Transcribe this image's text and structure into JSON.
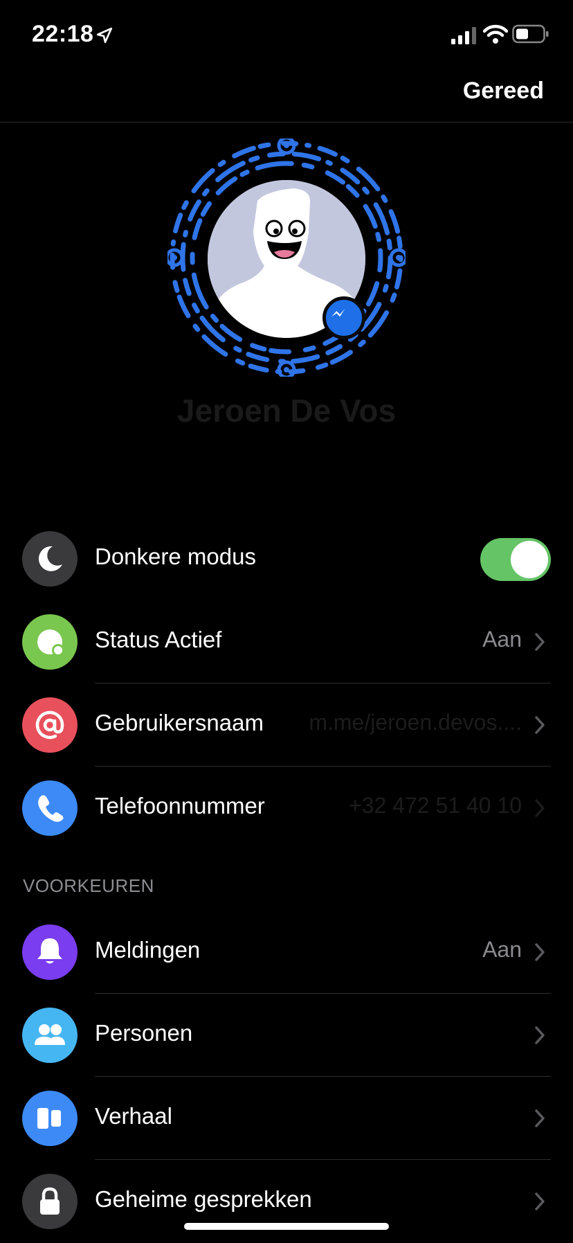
{
  "status_bar": {
    "time": "22:18"
  },
  "nav": {
    "done_label": "Gereed"
  },
  "profile": {
    "name": "Jeroen De Vos"
  },
  "rows": {
    "dark_mode": {
      "label": "Donkere modus",
      "toggle_on": true,
      "icon": "moon-icon",
      "color": "#3a3a3c"
    },
    "status": {
      "label": "Status Actief",
      "value": "Aan",
      "icon": "active-status-icon",
      "color": "#7ac74f"
    },
    "username": {
      "label": "Gebruikersnaam",
      "value": "m.me/jeroen.devos....",
      "icon": "at-icon",
      "color": "#e8505b"
    },
    "phone": {
      "label": "Telefoonnummer",
      "value": "+32 472 51 40 10",
      "icon": "phone-icon",
      "color": "#3d8af7"
    }
  },
  "preferences": {
    "section_title": "VOORKEUREN",
    "notifications": {
      "label": "Meldingen",
      "value": "Aan",
      "icon": "bell-icon",
      "color": "#7a3df0"
    },
    "people": {
      "label": "Personen",
      "icon": "people-icon",
      "color": "#46b6f2"
    },
    "story": {
      "label": "Verhaal",
      "icon": "story-icon",
      "color": "#3d8af7"
    },
    "secret": {
      "label": "Geheime gesprekken",
      "icon": "lock-icon",
      "color": "#3a3a3c"
    }
  }
}
